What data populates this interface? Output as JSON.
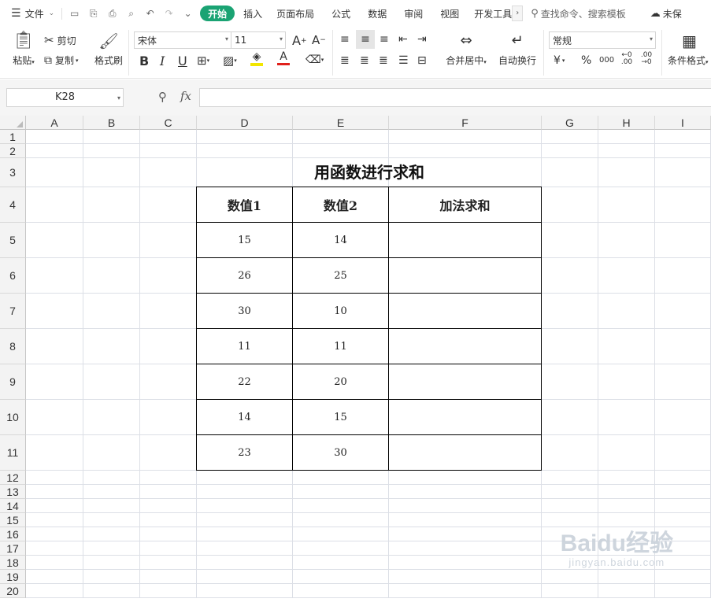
{
  "menubar": {
    "file_label": "文件",
    "tabs": [
      "开始",
      "插入",
      "页面布局",
      "公式",
      "数据",
      "审阅",
      "视图",
      "开发工具"
    ],
    "search_label": "查找命令、搜索模板",
    "unsaved_label": "未保"
  },
  "ribbon": {
    "paste_label": "粘贴",
    "cut_label": "剪切",
    "copy_label": "复制",
    "format_painter_label": "格式刷",
    "font_name": "宋体",
    "font_size": "11",
    "merge_label": "合并居中",
    "wrap_label": "自动换行",
    "number_format": "常规",
    "conditional_label": "条件格式",
    "currency_symbol": "¥",
    "percent_symbol": "%",
    "thousands_symbol": "000",
    "inc_decimal": "←0 .00",
    "dec_decimal": ".00 →0"
  },
  "formula_bar": {
    "name_box": "K28",
    "fx_label": "fx",
    "formula": ""
  },
  "sheet": {
    "columns": [
      "A",
      "B",
      "C",
      "D",
      "E",
      "F",
      "G",
      "H",
      "I"
    ],
    "rows": [
      "1",
      "2",
      "3",
      "4",
      "5",
      "6",
      "7",
      "8",
      "9",
      "10",
      "11",
      "12",
      "13",
      "14",
      "15",
      "16",
      "17",
      "18",
      "19",
      "20"
    ],
    "title": "用函数进行求和",
    "headers": [
      "数值1",
      "数值2",
      "加法求和"
    ],
    "data": [
      [
        "15",
        "14",
        ""
      ],
      [
        "26",
        "25",
        ""
      ],
      [
        "30",
        "10",
        ""
      ],
      [
        "11",
        "11",
        ""
      ],
      [
        "22",
        "20",
        ""
      ],
      [
        "14",
        "15",
        ""
      ],
      [
        "23",
        "30",
        ""
      ]
    ]
  },
  "watermark": {
    "brand": "Baidu经验",
    "url": "jingyan.baidu.com"
  }
}
